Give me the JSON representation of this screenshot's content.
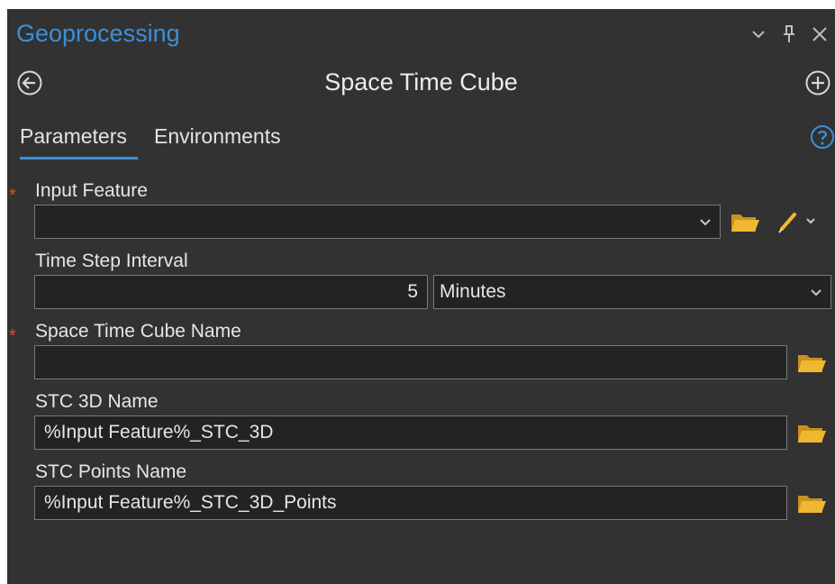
{
  "pane": {
    "title": "Geoprocessing",
    "title_icons": [
      "chevron-down-icon",
      "pin-icon",
      "close-icon"
    ]
  },
  "tool": {
    "title": "Space Time Cube",
    "back_icon": "back-arrow-icon",
    "add_icon": "add-circle-icon"
  },
  "tabs": {
    "parameters": "Parameters",
    "environments": "Environments",
    "active": "Parameters",
    "help_icon": "help-icon"
  },
  "params": {
    "input_feature": {
      "label": "Input Feature",
      "required": "*",
      "value": ""
    },
    "time_step": {
      "label": "Time Step Interval",
      "value": "5",
      "unit": "Minutes"
    },
    "cube_name": {
      "label": "Space Time Cube Name",
      "required": "*",
      "value": ""
    },
    "stc3d_name": {
      "label": "STC 3D Name",
      "value": "%Input Feature%_STC_3D"
    },
    "stc_points_name": {
      "label": "STC Points Name",
      "value": "%Input Feature%_STC_3D_Points"
    }
  },
  "colors": {
    "panel_bg": "#323232",
    "field_bg": "#232323",
    "accent": "#3c8fd8",
    "required": "#d9541e",
    "folder": "#f0b830"
  }
}
